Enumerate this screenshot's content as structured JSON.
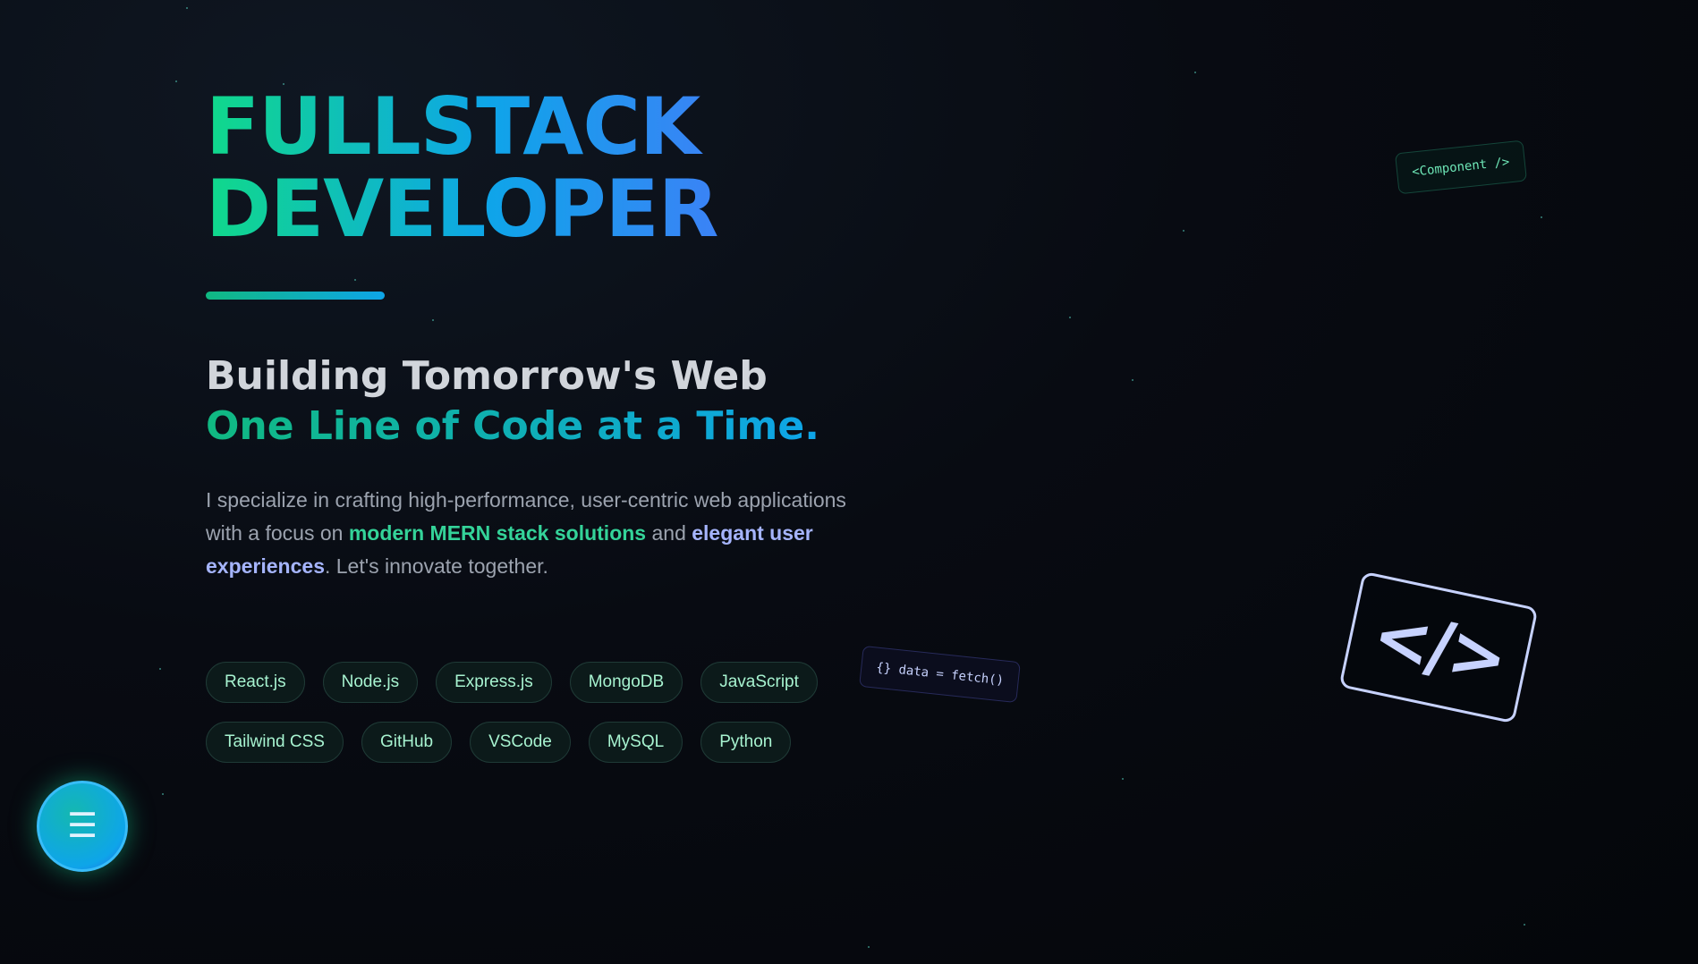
{
  "hero": {
    "title_line1": "FULLSTACK",
    "title_line2": "DEVELOPER",
    "subtitle_line1": "Building Tomorrow's Web",
    "subtitle_line2": "One Line of Code at a Time.",
    "desc_part1": "I specialize in crafting high-performance, user-centric web applications with a focus on ",
    "desc_highlight1": "modern MERN stack solutions",
    "desc_part2": " and ",
    "desc_highlight2": "elegant user experiences",
    "desc_part3": ". Let's innovate together."
  },
  "tags": {
    "row1": [
      "React.js",
      "Node.js",
      "Express.js",
      "MongoDB",
      "JavaScript"
    ],
    "row2": [
      "Tailwind CSS",
      "GitHub",
      "VSCode",
      "MySQL",
      "Python"
    ]
  },
  "floating": {
    "component_chip": "<Component />",
    "fetch_chip": "{} data = fetch()",
    "code_symbol": "</>"
  },
  "menu": {
    "icon": "hamburger-menu-icon",
    "glyph": "☰"
  },
  "colors": {
    "accent_green": "#10b981",
    "accent_blue": "#0ea5e9",
    "accent_indigo": "#a5b4fc",
    "background": "#05070c"
  }
}
